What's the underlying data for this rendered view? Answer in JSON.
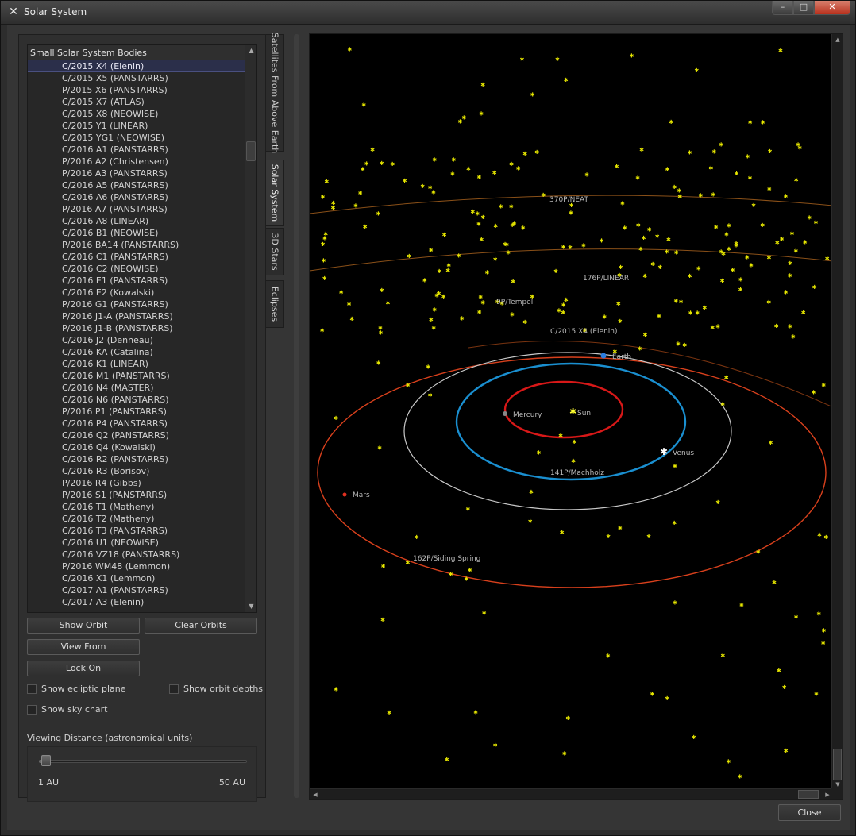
{
  "window": {
    "title": "Solar System",
    "app_icon": "x-logo-icon",
    "minimize": "–",
    "maximize": "□",
    "close": "✕"
  },
  "bodies_list": {
    "header": "Small Solar System Bodies",
    "selected_index": 0,
    "items": [
      "C/2015 X4 (Elenin)",
      "C/2015 X5 (PANSTARRS)",
      "P/2015 X6 (PANSTARRS)",
      "C/2015 X7 (ATLAS)",
      "C/2015 X8 (NEOWISE)",
      "C/2015 Y1 (LINEAR)",
      "C/2015 YG1 (NEOWISE)",
      "C/2016 A1 (PANSTARRS)",
      "P/2016 A2 (Christensen)",
      "P/2016 A3 (PANSTARRS)",
      "C/2016 A5 (PANSTARRS)",
      "C/2016 A6 (PANSTARRS)",
      "P/2016 A7 (PANSTARRS)",
      "C/2016 A8 (LINEAR)",
      "C/2016 B1 (NEOWISE)",
      "P/2016 BA14 (PANSTARRS)",
      "C/2016 C1 (PANSTARRS)",
      "C/2016 C2 (NEOWISE)",
      "C/2016 E1 (PANSTARRS)",
      "C/2016 E2 (Kowalski)",
      "P/2016 G1 (PANSTARRS)",
      "P/2016 J1-A (PANSTARRS)",
      "P/2016 J1-B (PANSTARRS)",
      "C/2016 J2 (Denneau)",
      "C/2016 KA (Catalina)",
      "C/2016 K1 (LINEAR)",
      "C/2016 M1 (PANSTARRS)",
      "C/2016 N4 (MASTER)",
      "C/2016 N6 (PANSTARRS)",
      "P/2016 P1 (PANSTARRS)",
      "C/2016 P4 (PANSTARRS)",
      "C/2016 Q2 (PANSTARRS)",
      "C/2016 Q4 (Kowalski)",
      "C/2016 R2 (PANSTARRS)",
      "C/2016 R3 (Borisov)",
      "P/2016 R4 (Gibbs)",
      "P/2016 S1 (PANSTARRS)",
      "C/2016 T1 (Matheny)",
      "C/2016 T2 (Matheny)",
      "C/2016 T3 (PANSTARRS)",
      "C/2016 U1 (NEOWISE)",
      "C/2016 VZ18 (PANSTARRS)",
      "P/2016 WM48 (Lemmon)",
      "C/2016 X1 (Lemmon)",
      "C/2017 A1 (PANSTARRS)",
      "C/2017 A3 (Elenin)"
    ]
  },
  "buttons": {
    "show_orbit": "Show Orbit",
    "clear_orbits": "Clear Orbits",
    "view_from": "View From",
    "lock_on": "Lock On",
    "close": "Close"
  },
  "checkboxes": {
    "ecliptic": {
      "label": "Show ecliptic plane",
      "checked": false
    },
    "orbit_depths": {
      "label": "Show orbit depths",
      "checked": false
    },
    "sky_chart": {
      "label": "Show sky chart",
      "checked": false
    }
  },
  "viewing_distance": {
    "label": "Viewing Distance (astronomical units)",
    "min_label": "1 AU",
    "max_label": "50 AU",
    "value_fraction": 0.02
  },
  "tabs": [
    {
      "label": "Satellites From Above Earth",
      "active": false
    },
    {
      "label": "Solar System",
      "active": true
    },
    {
      "label": "3D Stars",
      "active": false
    },
    {
      "label": "Eclipses",
      "active": false
    }
  ],
  "view_labels": {
    "sun": "Sun",
    "mercury": "Mercury",
    "venus": "Venus",
    "earth": "Earth",
    "mars": "Mars",
    "c2015x4": "C/2015 X4 (Elenin)",
    "p370": "370P/NEAT",
    "p176": "176P/LINEAR",
    "p9": "9P/Tempel",
    "p141": "141P/Machholz",
    "p162": "162P/Siding Spring"
  },
  "colors": {
    "background": "#000000",
    "asteroid": "#e6e600",
    "mercury_orbit": "#d81818",
    "venus_orbit": "#1a8fd0",
    "earth_orbit": "#c8c8c8",
    "mars_orbit": "#d8401c",
    "comet_orbit": "#a06020",
    "selected_row": "#2b2f4a"
  }
}
